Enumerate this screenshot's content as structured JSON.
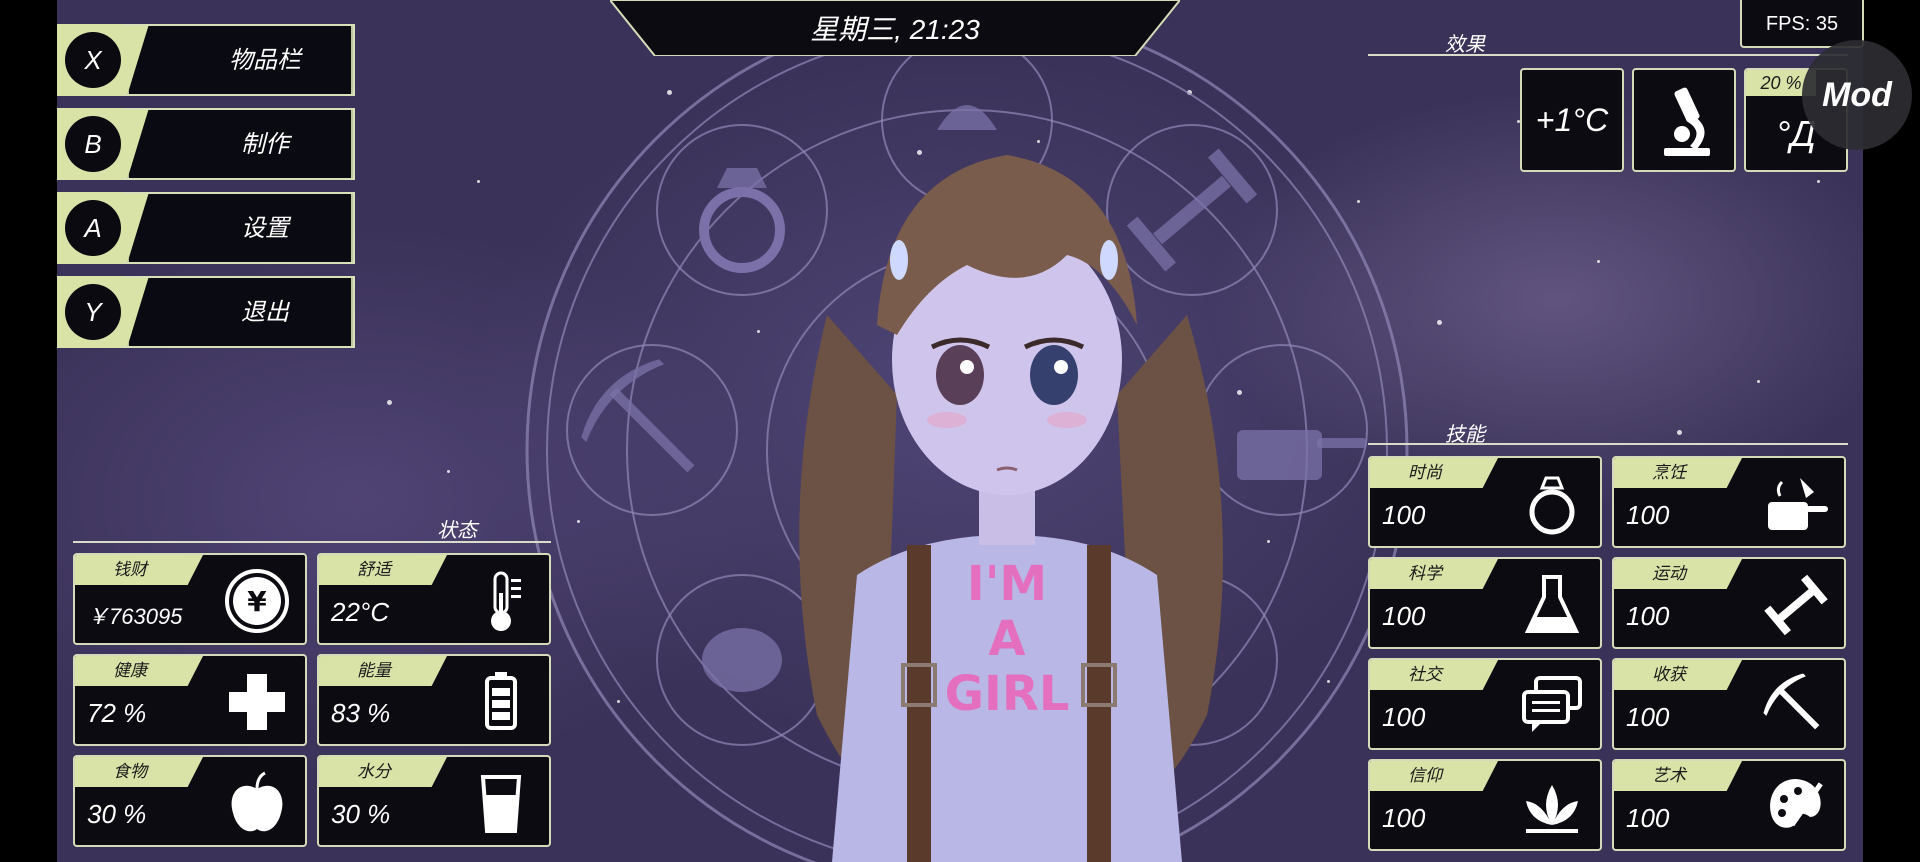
{
  "clock": {
    "text": "星期三, 21:23"
  },
  "fps": "FPS: 35",
  "mod_button": "Mod",
  "menu": [
    {
      "key": "X",
      "label": "物品栏",
      "icon": "inventory"
    },
    {
      "key": "B",
      "label": "制作",
      "icon": "crafting"
    },
    {
      "key": "A",
      "label": "设置",
      "icon": "settings"
    },
    {
      "key": "Y",
      "label": "退出",
      "icon": "exit"
    }
  ],
  "status": {
    "title": "状态",
    "cards": [
      {
        "title": "钱财",
        "value": "￥763095",
        "icon": "yen-coin-icon"
      },
      {
        "title": "舒适",
        "value": "22°C",
        "icon": "thermometer-icon"
      },
      {
        "title": "健康",
        "value": "72 %",
        "icon": "plus-icon"
      },
      {
        "title": "能量",
        "value": "83 %",
        "icon": "battery-icon"
      },
      {
        "title": "食物",
        "value": "30 %",
        "icon": "apple-icon"
      },
      {
        "title": "水分",
        "value": "30 %",
        "icon": "water-glass-icon"
      }
    ]
  },
  "effects": {
    "title": "效果",
    "items": [
      {
        "text": "+1°C",
        "icon": "temperature-bonus"
      },
      {
        "text": "",
        "icon": "microscope-icon"
      },
      {
        "text": "°Д",
        "badge": "20 %",
        "icon": "shock-face"
      }
    ]
  },
  "skills": {
    "title": "技能",
    "cards": [
      {
        "title": "时尚",
        "value": "100",
        "icon": "ring-icon"
      },
      {
        "title": "烹饪",
        "value": "100",
        "icon": "cooking-pot-icon"
      },
      {
        "title": "科学",
        "value": "100",
        "icon": "flask-icon"
      },
      {
        "title": "运动",
        "value": "100",
        "icon": "dumbbell-icon"
      },
      {
        "title": "社交",
        "value": "100",
        "icon": "chat-bubbles-icon"
      },
      {
        "title": "收获",
        "value": "100",
        "icon": "pickaxe-icon"
      },
      {
        "title": "信仰",
        "value": "100",
        "icon": "lotus-icon"
      },
      {
        "title": "艺术",
        "value": "100",
        "icon": "palette-icon"
      }
    ]
  },
  "colors": {
    "accent": "#d9e3a8",
    "panel": "#0c0b12",
    "background": "#4a4172",
    "character_shirt": "#b9b7e6",
    "shirt_print": "#e46fbf"
  },
  "character": {
    "shirt_text": [
      "I'M",
      "A",
      "GIRL"
    ]
  }
}
